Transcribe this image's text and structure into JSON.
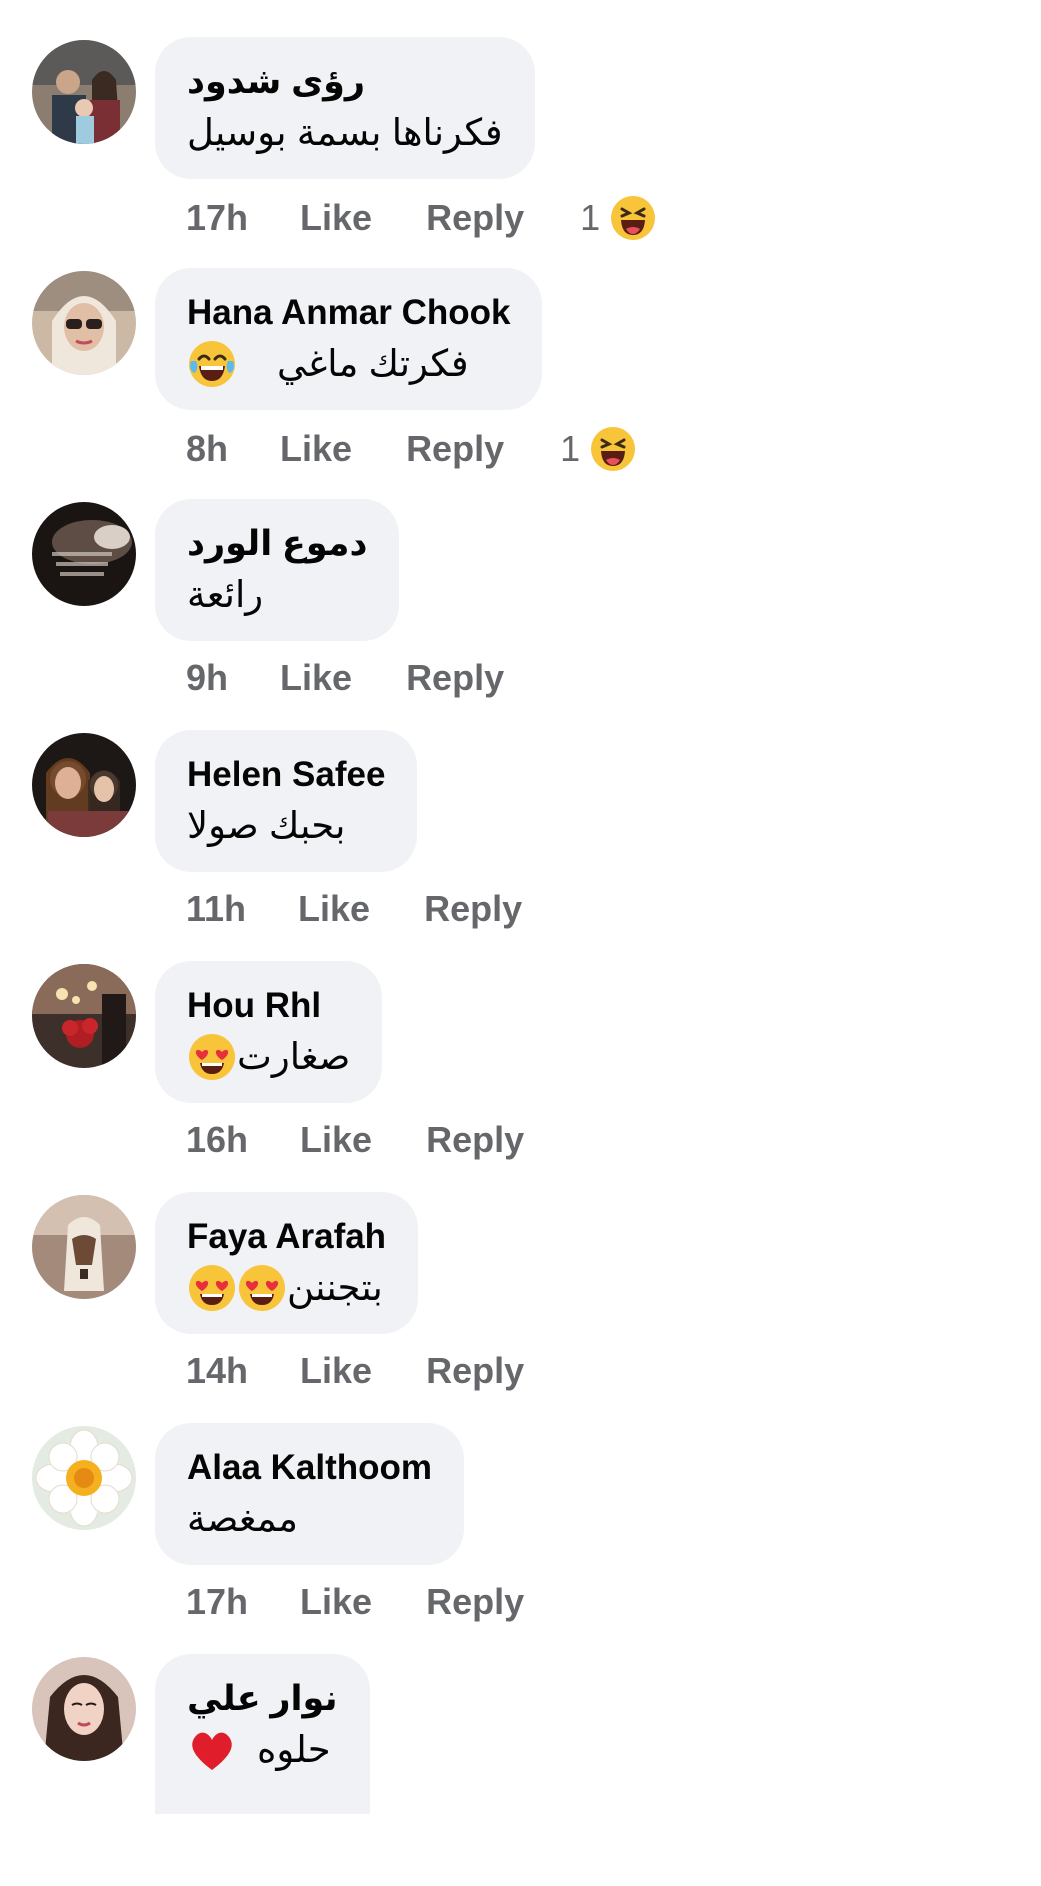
{
  "comments": [
    {
      "author": "رؤى شدود",
      "text": "فكرناها بسمة بوسيل",
      "emoji": [],
      "time": "17h",
      "like": "Like",
      "reply": "Reply",
      "reaction": {
        "count": "1",
        "icon": "haha-reaction-icon"
      },
      "avatar_colors": [
        "#7d6f62",
        "#c9b8a6"
      ]
    },
    {
      "author": "Hana Anmar Chook",
      "text": "فكرتك ماغي",
      "emoji": [
        "tears-of-joy-emoji"
      ],
      "time": "8h",
      "like": "Like",
      "reply": "Reply",
      "reaction": {
        "count": "1",
        "icon": "haha-reaction-icon"
      },
      "avatar_colors": [
        "#b69a7a",
        "#e7d8c8"
      ]
    },
    {
      "author": "دموع الورد",
      "text": "رائعة",
      "emoji": [],
      "time": "9h",
      "like": "Like",
      "reply": "Reply",
      "reaction": null,
      "avatar_colors": [
        "#1c1715",
        "#6a5a50"
      ]
    },
    {
      "author": "Helen Safee",
      "text": "بحبك صولا",
      "emoji": [],
      "time": "11h",
      "like": "Like",
      "reply": "Reply",
      "reaction": null,
      "avatar_colors": [
        "#2a2320",
        "#b98b6d"
      ]
    },
    {
      "author": "Hou Rhl",
      "text": "صغارت",
      "emoji": [
        "heart-eyes-emoji"
      ],
      "time": "16h",
      "like": "Like",
      "reply": "Reply",
      "reaction": null,
      "avatar_colors": [
        "#4a3a33",
        "#c89a7c"
      ]
    },
    {
      "author": "Faya Arafah",
      "text": "بتجننن",
      "emoji": [
        "heart-eyes-emoji",
        "heart-eyes-emoji"
      ],
      "time": "14h",
      "like": "Like",
      "reply": "Reply",
      "reaction": null,
      "avatar_colors": [
        "#6b5548",
        "#d8c4b3"
      ]
    },
    {
      "author": "Alaa Kalthoom",
      "text": "ممغصة",
      "emoji": [],
      "time": "17h",
      "like": "Like",
      "reply": "Reply",
      "reaction": null,
      "avatar_colors": [
        "#f4c542",
        "#e9efe6"
      ]
    },
    {
      "author": "نوار علي",
      "text": "حلوه",
      "emoji": [
        "red-heart-emoji"
      ],
      "time": "",
      "like": "",
      "reply": "",
      "reaction": null,
      "avatar_colors": [
        "#3a2a26",
        "#e1c5b8"
      ]
    }
  ]
}
